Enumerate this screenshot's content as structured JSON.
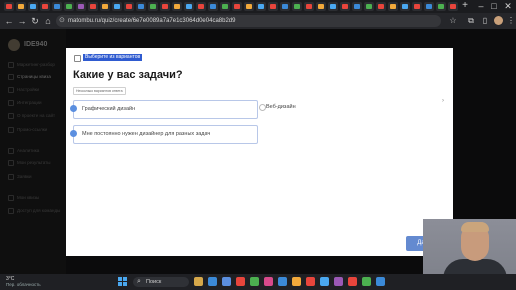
{
  "browser": {
    "url": "matombu.ru/quiz/create/6e7e0089a7a7e1c3064d0e04ca8b2d9",
    "tab_colors": [
      "#e8453c",
      "#f2a93b",
      "#4aa8f0",
      "#e8453c",
      "#3b8ad8",
      "#4cb050",
      "#9b59b6",
      "#e8453c",
      "#f2a93b",
      "#4aa8f0",
      "#e8453c",
      "#3b8ad8",
      "#4cb050",
      "#e8453c",
      "#f2a93b",
      "#4aa8f0",
      "#e8453c",
      "#3b8ad8",
      "#4cb050",
      "#e8453c",
      "#f2a93b",
      "#4aa8f0",
      "#e8453c",
      "#3b8ad8",
      "#4cb050",
      "#e8453c",
      "#f2a93b",
      "#4aa8f0",
      "#e8453c",
      "#3b8ad8",
      "#4cb050",
      "#e8453c",
      "#f2a93b",
      "#4aa8f0",
      "#e8453c",
      "#3b8ad8",
      "#4cb050",
      "#e8453c"
    ]
  },
  "app": {
    "logo_text": "IDE940",
    "sidebar_items": [
      "Маркетинг-разбор",
      "Страницы квиза",
      "Настройки",
      "Интеграции",
      "О проекте на сайт",
      "Промо-ссылки",
      "Аналитика",
      "Мои результаты",
      "Заявки",
      "Мои квизы",
      "Доступ для команды"
    ]
  },
  "modal": {
    "crumb": "Выберите из вариантов",
    "title": "Какие у вас задачи?",
    "hint": "Несколько вариантов ответа",
    "options": [
      "Графический дизайн",
      "Веб-дизайн",
      "Мне постоянно нужен дизайнер для разных задач"
    ],
    "next_label": "Да"
  },
  "taskbar": {
    "temp": "3°C",
    "weather": "Пер. облачность",
    "search": "Поиск",
    "app_colors": [
      "#d6a84a",
      "#3b8ad8",
      "#5b8fe0",
      "#e8453c",
      "#4cb050",
      "#d84a8c",
      "#3b8ad8",
      "#f2a93b",
      "#e8453c",
      "#4aa8f0",
      "#9b59b6",
      "#e8453c",
      "#4cb050",
      "#3b8ad8"
    ]
  }
}
